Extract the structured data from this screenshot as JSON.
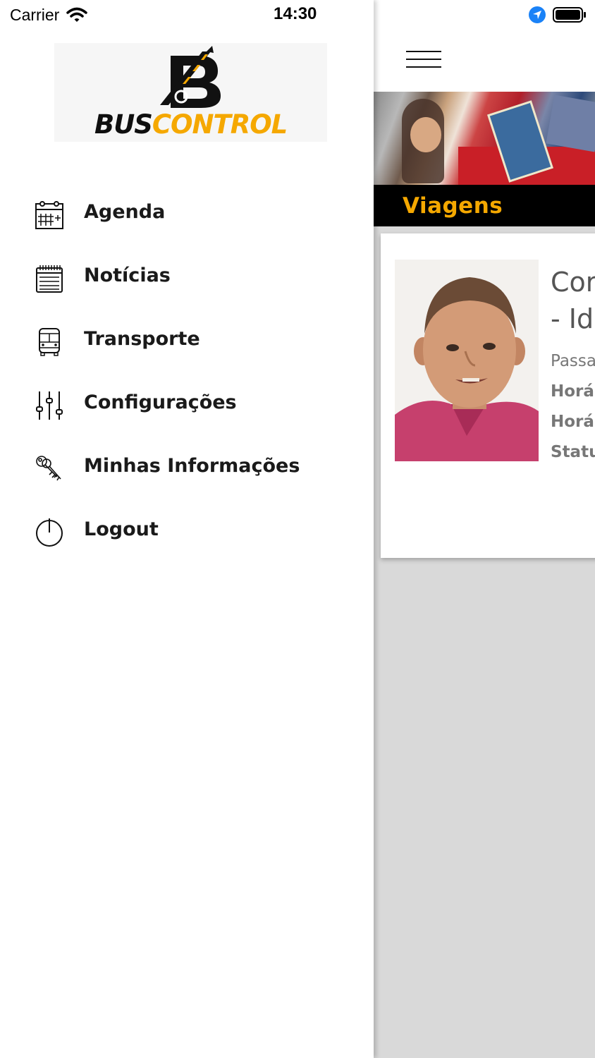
{
  "status_bar": {
    "carrier": "Carrier",
    "time": "14:30"
  },
  "brand": {
    "name_part1": "BUS",
    "name_part2": "CONTROL",
    "accent_color": "#f5a800"
  },
  "menu": {
    "items": [
      {
        "label": "Agenda",
        "icon": "calendar-icon"
      },
      {
        "label": "Notícias",
        "icon": "notepad-icon"
      },
      {
        "label": "Transporte",
        "icon": "bus-icon"
      },
      {
        "label": "Configurações",
        "icon": "sliders-icon"
      },
      {
        "label": "Minhas Informações",
        "icon": "keys-icon"
      },
      {
        "label": "Logout",
        "icon": "power-icon"
      }
    ]
  },
  "main": {
    "section_title": "Viagens",
    "card": {
      "title_line1": "Cor",
      "title_line2": "- Id",
      "subtitle": "Passa",
      "field1": "Horá",
      "field2": "Horá",
      "field3": "Statu"
    }
  }
}
